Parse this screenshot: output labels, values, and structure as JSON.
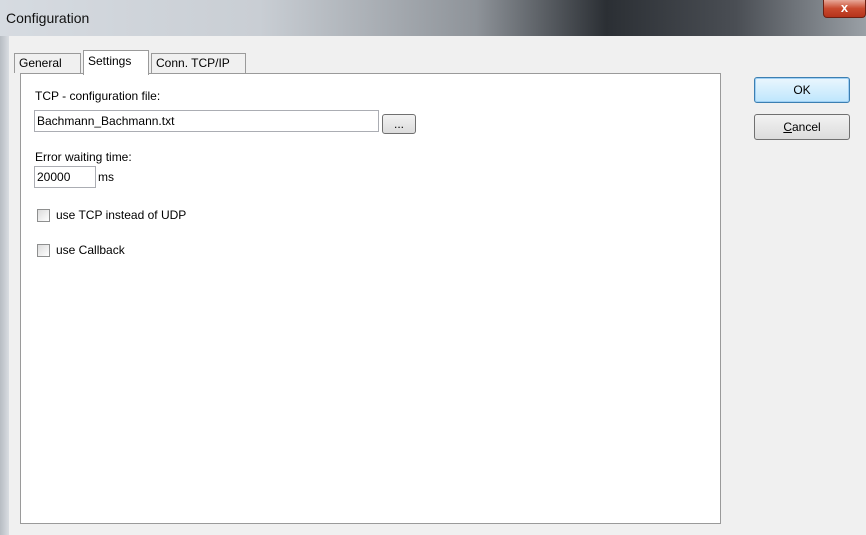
{
  "window": {
    "title": "Configuration",
    "close_glyph": "x"
  },
  "tabs": [
    {
      "label": "General",
      "active": false
    },
    {
      "label": "Settings",
      "active": true
    },
    {
      "label": "Conn. TCP/IP",
      "active": false
    }
  ],
  "settings": {
    "tcp_file_label": "TCP - configuration file:",
    "tcp_file_value": "Bachmann_Bachmann.txt",
    "browse_label": "...",
    "error_time_label": "Error waiting time:",
    "error_time_value": "20000",
    "error_time_unit": "ms",
    "use_tcp_label": "use TCP instead of UDP",
    "use_tcp_checked": false,
    "use_callback_label": "use Callback",
    "use_callback_checked": false
  },
  "buttons": {
    "ok_label": "OK",
    "cancel_first": "C",
    "cancel_rest": "ancel"
  }
}
